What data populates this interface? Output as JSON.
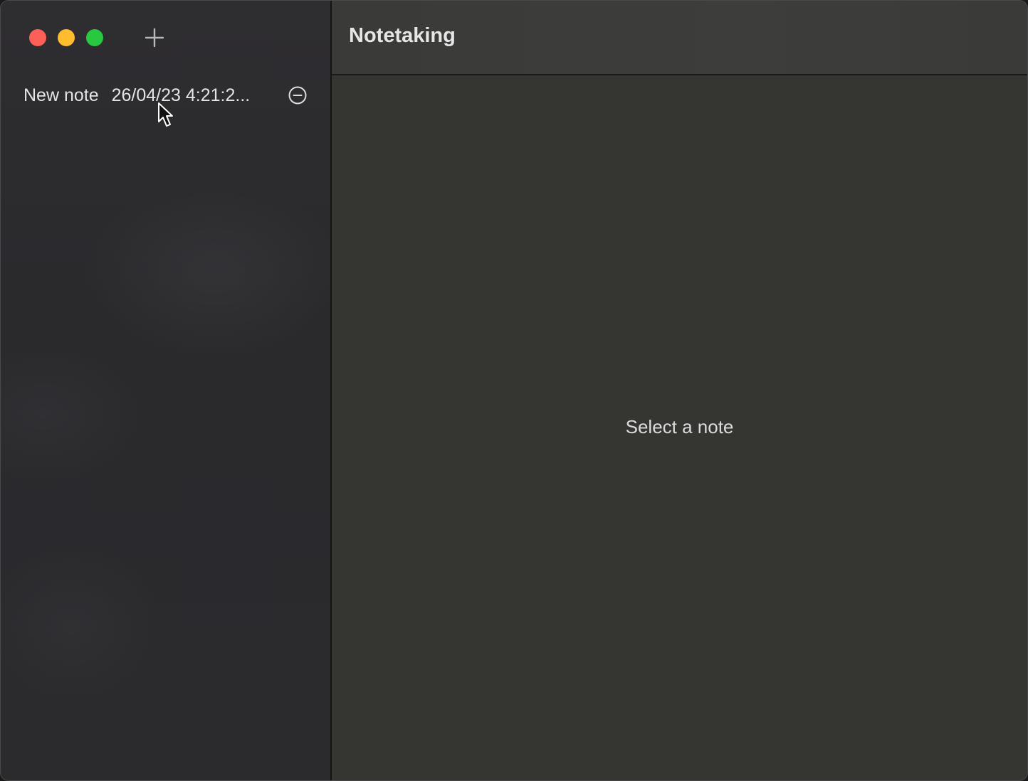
{
  "window": {
    "controls": [
      "close",
      "minimize",
      "maximize"
    ]
  },
  "sidebar": {
    "add_icon": "plus-icon",
    "notes": [
      {
        "title": "New note",
        "date": "26/04/23 4:21:2...",
        "remove_icon": "minus-circle-icon"
      }
    ]
  },
  "main": {
    "title": "Notetaking",
    "placeholder": "Select a note"
  },
  "colors": {
    "close": "#fe5f57",
    "minimize": "#febc2e",
    "maximize": "#28c840",
    "sidebar_bg": "#2b2b2e",
    "content_bg": "#353532"
  }
}
